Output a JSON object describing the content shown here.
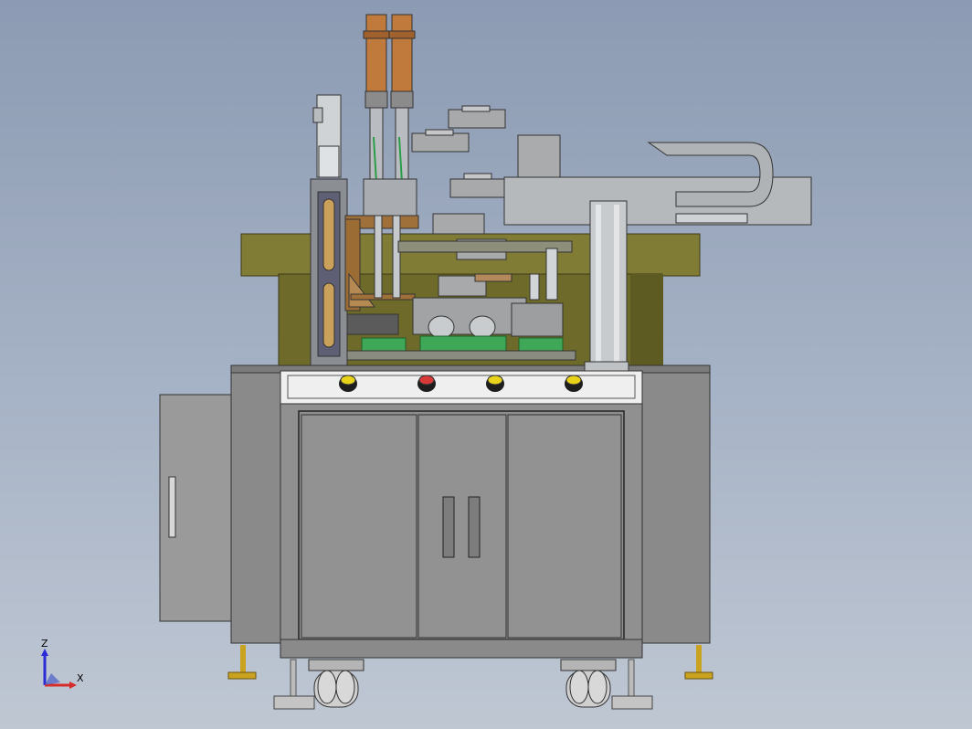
{
  "scene": {
    "background_top": "#8c9bb3",
    "background_bottom": "#bfc7d3",
    "cabinet_color": "#8f8f8f",
    "panel_color": "#eeeeee",
    "turntable_color": "#7d7a32",
    "copper_color": "#c07a3c",
    "bracket_color": "#a0703a",
    "fixture_color": "#3fa858"
  },
  "buttons": [
    {
      "name": "yellow-push-button-1",
      "color": "#e8d21a"
    },
    {
      "name": "red-emergency-button",
      "color": "#d83a3a"
    },
    {
      "name": "yellow-push-button-2",
      "color": "#e8d21a"
    },
    {
      "name": "yellow-push-button-3",
      "color": "#e8d21a"
    }
  ],
  "triad": {
    "z_label": "Z",
    "x_label": "X",
    "z_color": "#2b2bd6",
    "x_color": "#d62b2b"
  }
}
